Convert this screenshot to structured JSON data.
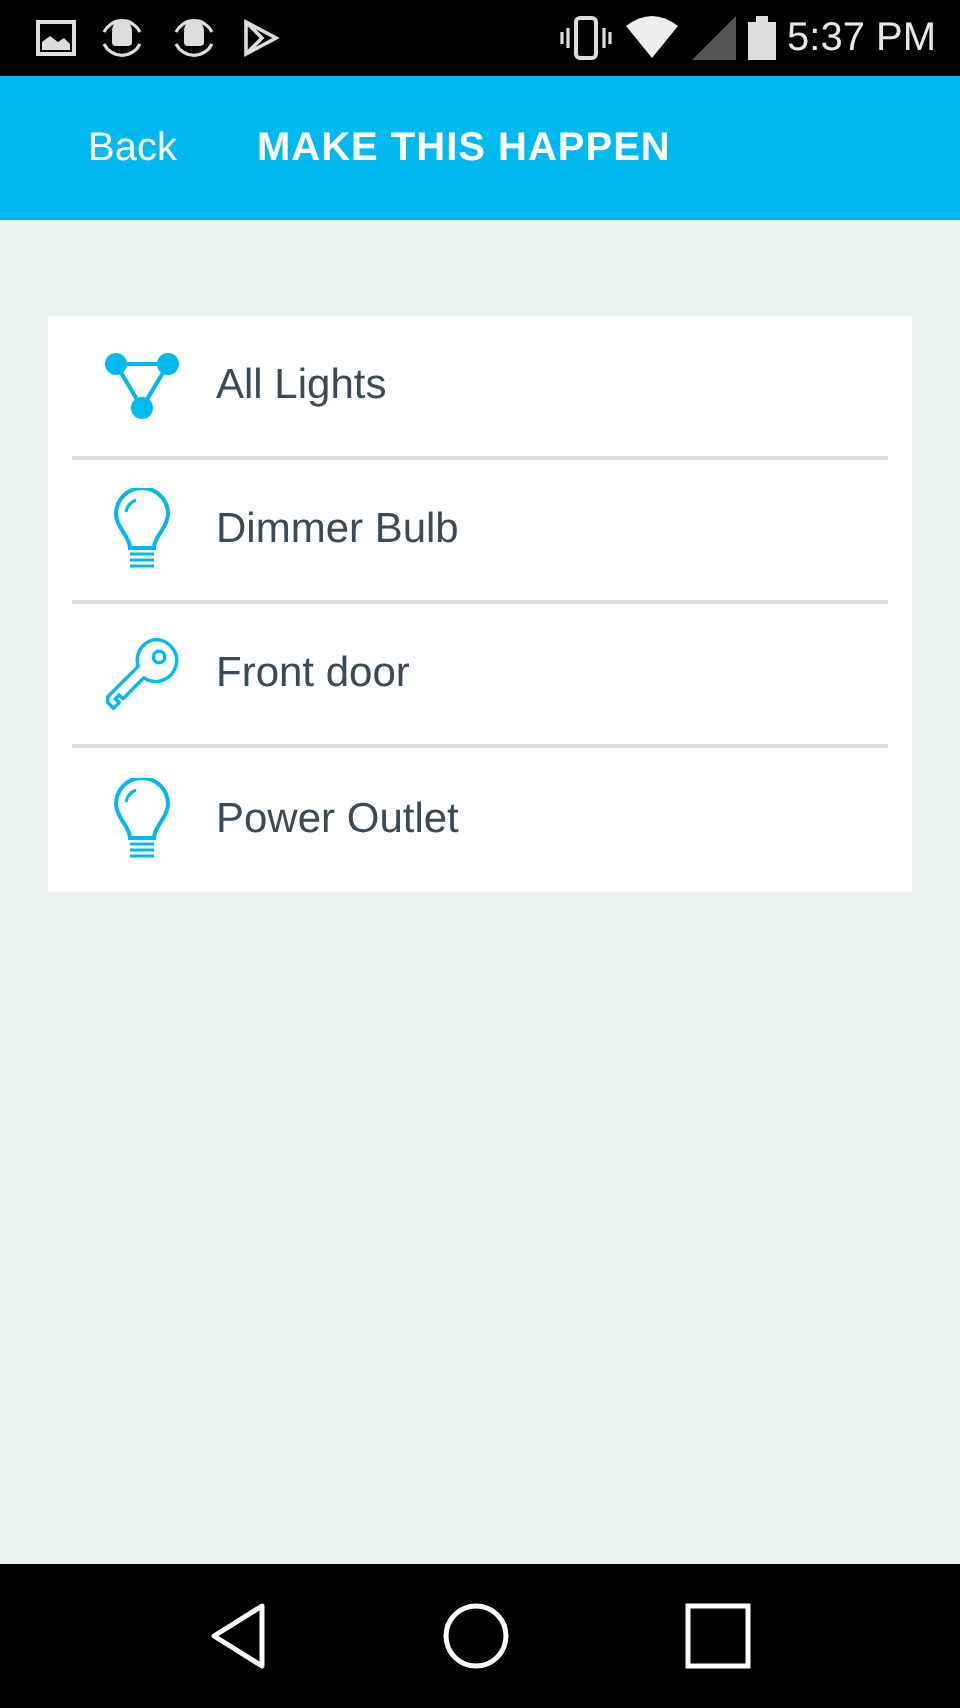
{
  "status_bar": {
    "time": "5:37 PM"
  },
  "header": {
    "back": "Back",
    "title": "MAKE THIS HAPPEN"
  },
  "items": [
    {
      "kind": "group",
      "label": "All Lights"
    },
    {
      "kind": "bulb",
      "label": "Dimmer Bulb"
    },
    {
      "kind": "key",
      "label": "Front door"
    },
    {
      "kind": "bulb",
      "label": "Power Outlet"
    }
  ]
}
